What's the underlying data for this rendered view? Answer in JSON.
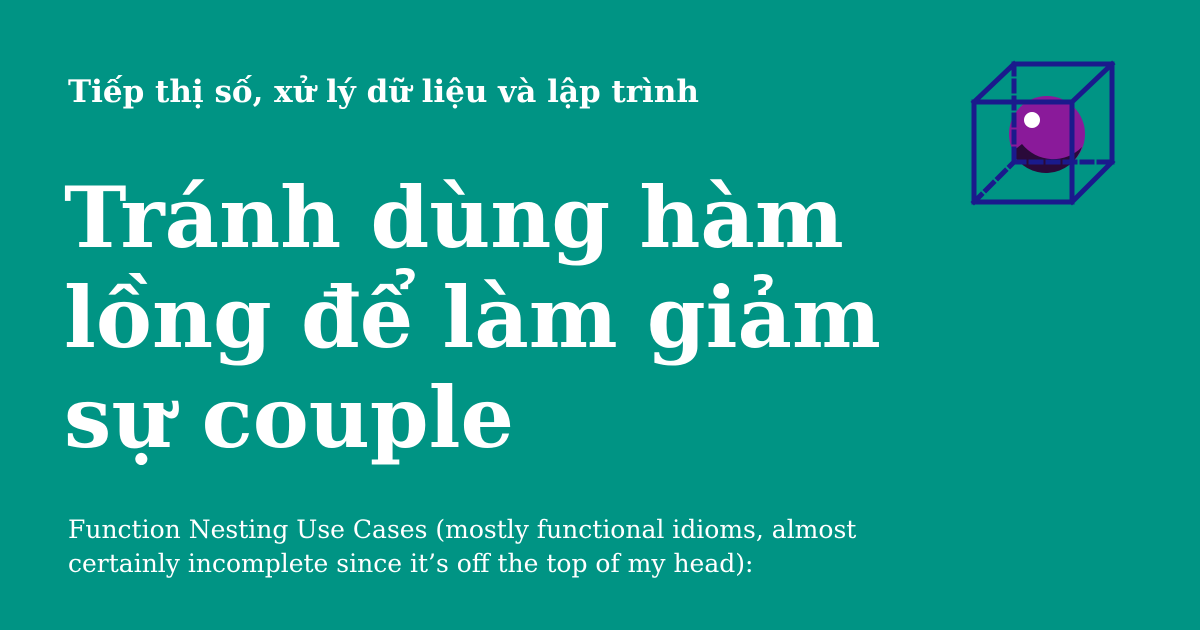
{
  "category": "Tiếp thị số, xử lý dữ liệu và lập trình",
  "title": "Tránh dùng hàm lồng để làm giảm sự couple",
  "excerpt": "Function Nesting Use Cases (mostly functional idioms, almost certainly incomplete since it’s off the top of my head):",
  "logo": {
    "icon": "cube-with-sphere-icon",
    "colors": {
      "cube": "#1a1a8c",
      "sphere": "#8a1a9a",
      "sphere_shadow": "#000000",
      "highlight": "#ffffff"
    }
  },
  "colors": {
    "background": "#009484",
    "text": "#ffffff"
  }
}
